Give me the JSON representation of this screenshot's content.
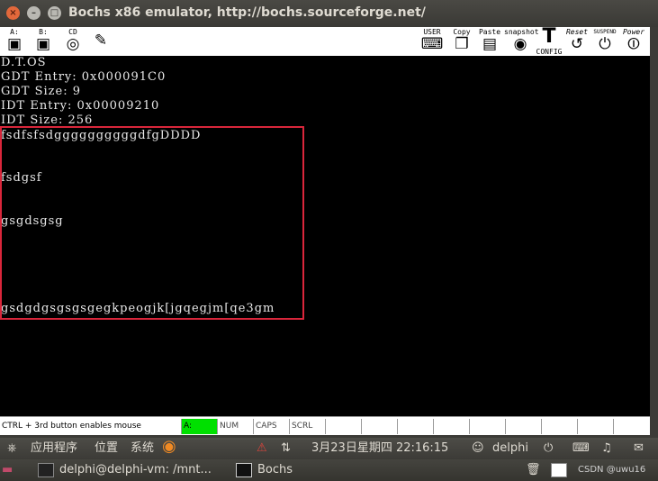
{
  "window": {
    "title": "Bochs x86 emulator, http://bochs.sourceforge.net/",
    "close_glyph": "×",
    "min_glyph": "–",
    "max_glyph": "□"
  },
  "toolbar": {
    "floppy_a_label": "A:",
    "floppy_b_label": "B:",
    "cdrom_label": "CD",
    "user_label": "USER",
    "copy_label": "Copy",
    "paste_label": "Paste",
    "snapshot_label": "snapshot",
    "config_label": "CONFIG",
    "config_glyph": "T",
    "reset_label": "Reset",
    "suspend_label": "SUSPEND",
    "power_label": "Power"
  },
  "screen": {
    "lines": [
      "D.T.OS",
      "GDT Entry: 0x000091C0",
      "GDT Size: 9",
      "IDT Entry: 0x00009210",
      "IDT Size: 256",
      "fsdfsfsdggggggggggdfgDDDD",
      "fsdgsf",
      "gsgdsgsg",
      "gsdgdgsgsgsgegkpeogjk[jgqegjm[qe3gm"
    ]
  },
  "statusbar": {
    "hint": "CTRL + 3rd button enables mouse",
    "drive": "A:",
    "num": "NUM",
    "caps": "CAPS",
    "scrl": "SCRL"
  },
  "panel": {
    "apps": "应用程序",
    "places": "位置",
    "system": "系统",
    "datetime": "3月23日星期四 22:16:15",
    "user": "delphi"
  },
  "taskbar": {
    "terminal": "delphi@delphi-vm: /mnt...",
    "bochs": "Bochs",
    "watermark": "CSDN @uwu16"
  },
  "colors": {
    "highlight_box": "#d9263b",
    "drive_active": "#00e000",
    "close_button": "#e2683b"
  }
}
